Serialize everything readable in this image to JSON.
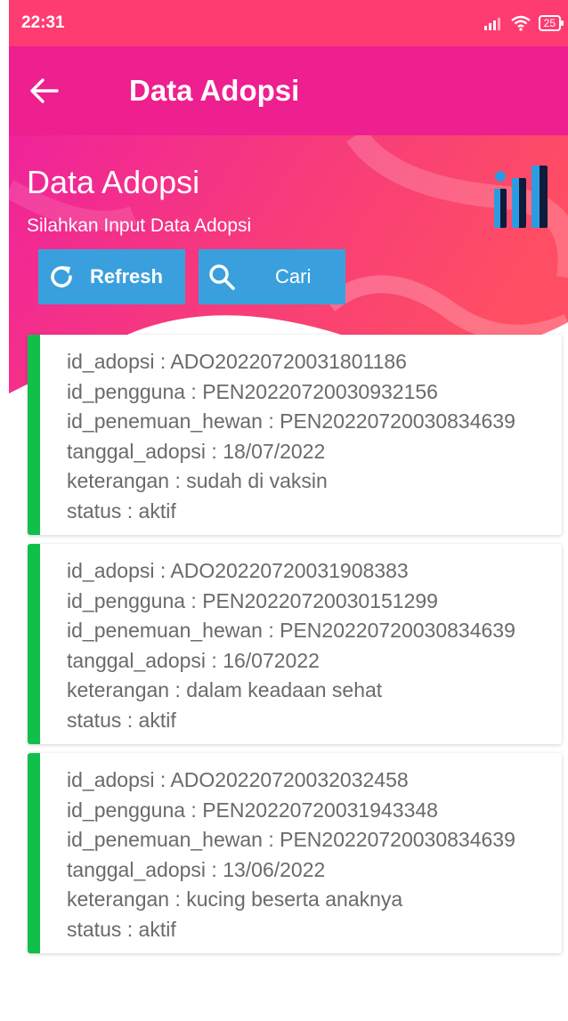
{
  "status_bar": {
    "time": "22:31",
    "battery": "25",
    "colors": {
      "background": "#ff3c72"
    }
  },
  "toolbar": {
    "title": "Data Adopsi",
    "back_icon": "arrow-left-icon",
    "color": "#ee1f8e"
  },
  "header": {
    "title": "Data Adopsi",
    "subtitle": "Silahkan Input Data Adopsi",
    "logo_icon": "bar-chart-logo-icon"
  },
  "buttons": {
    "refresh_label": "Refresh",
    "refresh_icon": "refresh-icon",
    "search_label": "Cari",
    "search_icon": "search-icon",
    "color": "#3aa0dd"
  },
  "card_accent": "#10c04a",
  "records": [
    {
      "id_adopsi": "id_adopsi : ADO20220720031801186",
      "id_pengguna": "id_pengguna : PEN20220720030932156",
      "id_penemuan_hewan": "id_penemuan_hewan : PEN20220720030834639",
      "tanggal_adopsi": "tanggal_adopsi : 18/07/2022",
      "keterangan": "keterangan : sudah di vaksin",
      "status": "status : aktif"
    },
    {
      "id_adopsi": "id_adopsi : ADO20220720031908383",
      "id_pengguna": "id_pengguna : PEN20220720030151299",
      "id_penemuan_hewan": "id_penemuan_hewan : PEN20220720030834639",
      "tanggal_adopsi": "tanggal_adopsi : 16/072022",
      "keterangan": "keterangan : dalam keadaan sehat",
      "status": "status : aktif"
    },
    {
      "id_adopsi": "id_adopsi : ADO20220720032032458",
      "id_pengguna": "id_pengguna : PEN20220720031943348",
      "id_penemuan_hewan": "id_penemuan_hewan : PEN20220720030834639",
      "tanggal_adopsi": "tanggal_adopsi : 13/06/2022",
      "keterangan": "keterangan : kucing beserta anaknya",
      "status": "status : aktif"
    }
  ]
}
